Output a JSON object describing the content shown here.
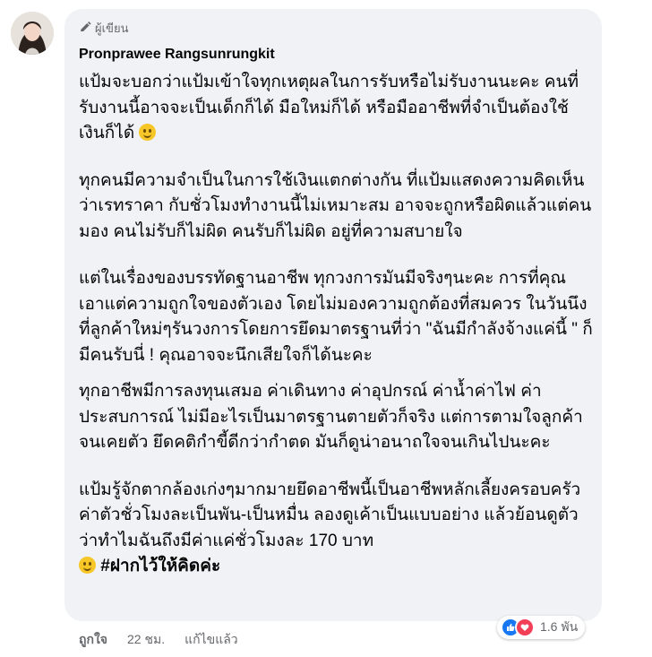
{
  "comment": {
    "author_badge": "ผู้เขียน",
    "author_name": "Pronprawee Rangsunrungkit",
    "paragraphs": [
      "แป้มจะบอกว่าแป้มเข้าใจทุกเหตุผลในการรับหรือไม่รับงานนะคะ คนที่รับงานนี้อาจจะเป็นเด็กก็ได้ มือใหม่ก็ได้ หรือมืออาชีพที่จำเป็นต้องใช้เงินก็ได้",
      "ทุกคนมีความจำเป็นในการใช้เงินแตกต่างกัน ที่แป้มแสดงความคิดเห็นว่าเรทราคา กับชั่วโมงทำงานนี้ไม่เหมาะสม อาจจะถูกหรือผิดแล้วแต่คนมอง คนไม่รับก็ไม่ผิด คนรับก็ไม่ผิด อยู่ที่ความสบายใจ",
      "แต่ในเรื่องของบรรทัดฐานอาชีพ ทุกวงการมันมีจริงๆนะคะ การที่คุณเอาแต่ความถูกใจของตัวเอง โดยไม่มองความถูกต้องที่สมควร ในวันนึงที่ลูกค้าใหม่ๆรันวงการโดยการยึดมาตรฐานที่ว่า \"ฉันมีกำลังจ้างแค่นี้ \" ก็มีคนรับนี่ ! คุณอาจจะนึกเสียใจก็ได้นะคะ",
      "ทุกอาชีพมีการลงทุนเสมอ ค่าเดินทาง ค่าอุปกรณ์ ค่าน้ำค่าไฟ ค่าประสบการณ์ ไม่มีอะไรเป็นมาตรฐานตายตัวก็จริง แต่การตามใจลูกค้าจนเคยตัว ยึดคติกำขี้ดีกว่ากำตด มันก็ดูน่าอนาถใจจนเกินไปนะคะ",
      "แป้มรู้จักตากล้องเก่งๆมากมายยึดอาชีพนี้เป็นอาชีพหลักเลี้ยงครอบครัว ค่าตัวชั่วโมงละเป็นพัน-เป็นหมื่น ลองดูเค้าเป็นแบบอย่าง แล้วย้อนดูตัวว่าทำไมฉันถึงมีค่าแค่ชั่วโมงละ 170 บาท"
    ],
    "hashtag": "#ฝากไว้ให้คิดค่ะ",
    "reaction_count": "1.6 พัน",
    "like_label": "ถูกใจ",
    "time_label": "22 ชม.",
    "edited_label": "แก้ไขแล้ว"
  },
  "colors": {
    "bubble_bg": "#f0f2f5",
    "text": "#050505",
    "secondary": "#65676b",
    "like_blue": "#1877f2",
    "love_red": "#f33e58"
  },
  "icons": [
    "avatar-photo",
    "pen-icon",
    "smile-emoji",
    "like-reaction-icon",
    "love-reaction-icon"
  ]
}
